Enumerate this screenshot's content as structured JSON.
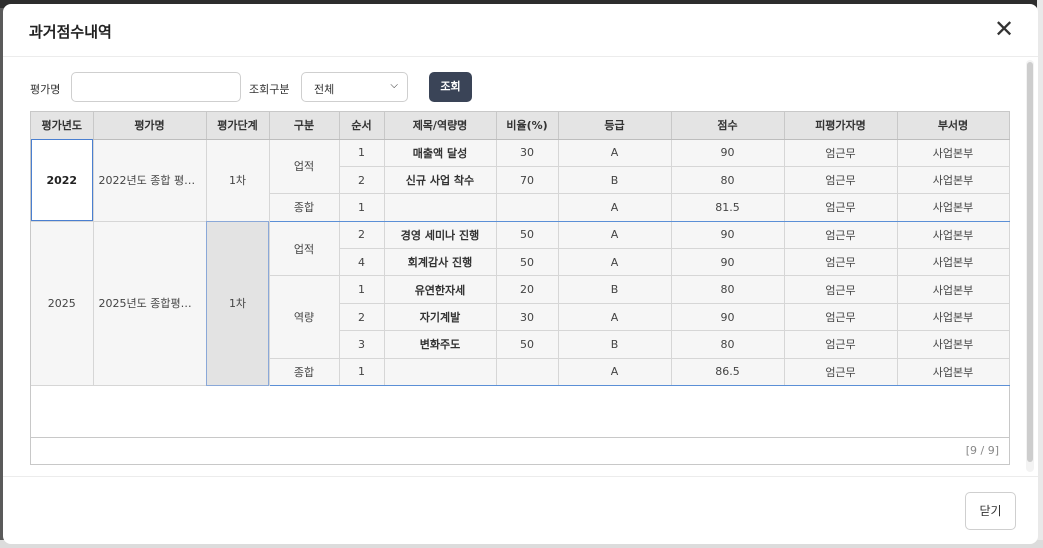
{
  "modal": {
    "title": "과거점수내역",
    "close_icon": "close-icon",
    "footer_close": "닫기"
  },
  "search": {
    "name_label": "평가명",
    "name_value": "",
    "type_label": "조회구분",
    "type_value": "전체",
    "search_button": "조회"
  },
  "table": {
    "headers": [
      "평가년도",
      "평가명",
      "평가단계",
      "구분",
      "순서",
      "제목/역량명",
      "비율(%)",
      "등급",
      "점수",
      "피평가자명",
      "부서명"
    ],
    "group1": {
      "year": "2022",
      "name": "2022년도 종합 평…",
      "stage": "1차",
      "cat_a": "업적",
      "cat_b": "종합",
      "rows": [
        {
          "order": "1",
          "title": "매출액 달성",
          "ratio": "30",
          "grade": "A",
          "score": "90",
          "person": "엄근무",
          "dept": "사업본부"
        },
        {
          "order": "2",
          "title": "신규 사업 착수",
          "ratio": "70",
          "grade": "B",
          "score": "80",
          "person": "엄근무",
          "dept": "사업본부"
        },
        {
          "order": "1",
          "title": "",
          "ratio": "",
          "grade": "A",
          "score": "81.5",
          "person": "엄근무",
          "dept": "사업본부"
        }
      ]
    },
    "group2": {
      "year": "2025",
      "name": "2025년도 종합평…",
      "stage": "1차",
      "cat_a": "업적",
      "cat_b": "역량",
      "cat_c": "종합",
      "rows": [
        {
          "order": "2",
          "title": "경영 세미나 진행",
          "ratio": "50",
          "grade": "A",
          "score": "90",
          "person": "엄근무",
          "dept": "사업본부"
        },
        {
          "order": "4",
          "title": "회계감사 진행",
          "ratio": "50",
          "grade": "A",
          "score": "90",
          "person": "엄근무",
          "dept": "사업본부"
        },
        {
          "order": "1",
          "title": "유연한자세",
          "ratio": "20",
          "grade": "B",
          "score": "80",
          "person": "엄근무",
          "dept": "사업본부"
        },
        {
          "order": "2",
          "title": "자기계발",
          "ratio": "30",
          "grade": "A",
          "score": "90",
          "person": "엄근무",
          "dept": "사업본부"
        },
        {
          "order": "3",
          "title": "변화주도",
          "ratio": "50",
          "grade": "B",
          "score": "80",
          "person": "엄근무",
          "dept": "사업본부"
        },
        {
          "order": "1",
          "title": "",
          "ratio": "",
          "grade": "A",
          "score": "86.5",
          "person": "엄근무",
          "dept": "사업본부"
        }
      ]
    },
    "pager": "[9 / 9]"
  }
}
